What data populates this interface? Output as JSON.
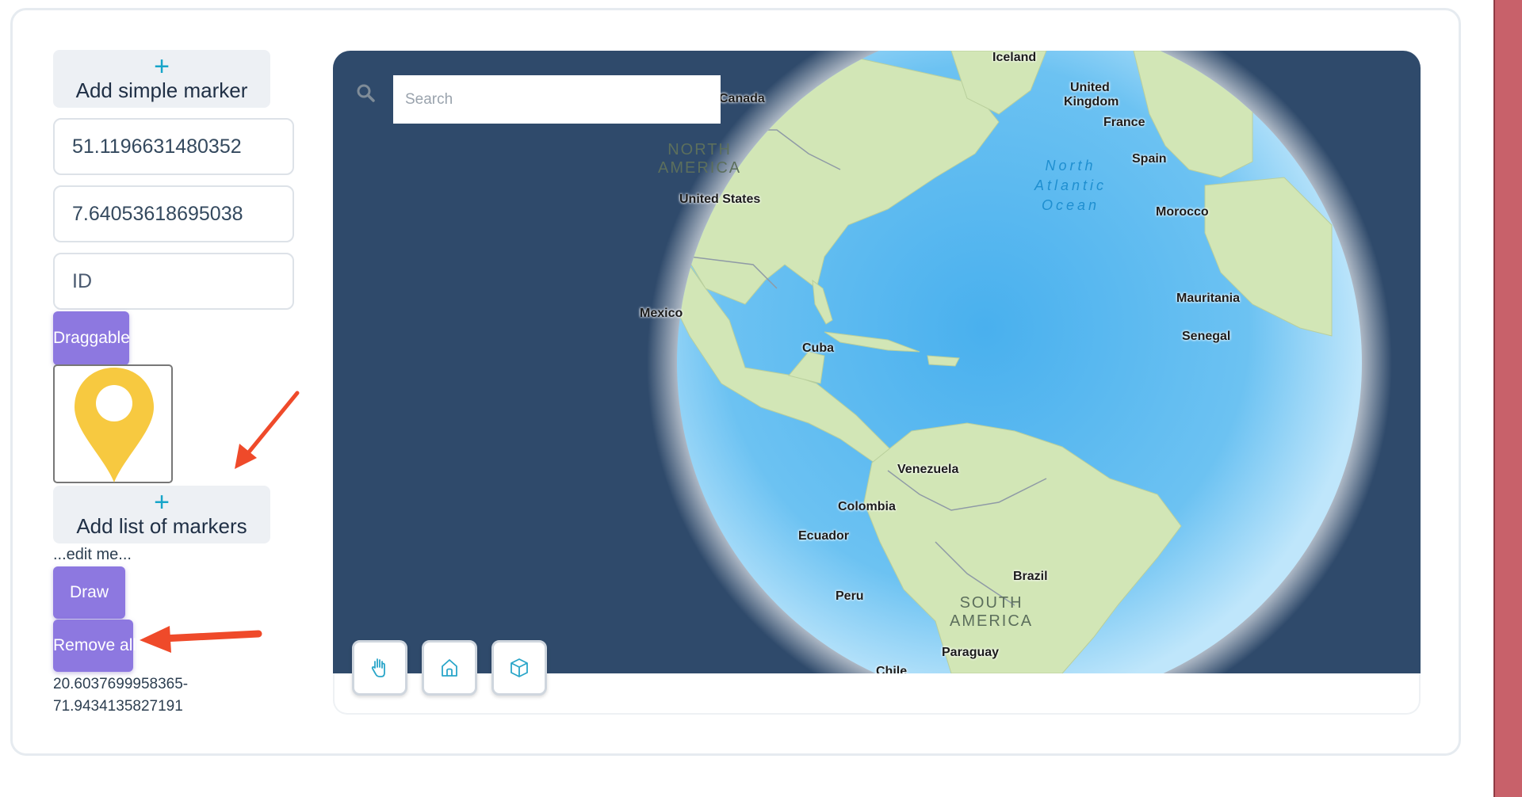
{
  "left_panel": {
    "add_simple_marker": {
      "icon": "plus",
      "label": "Add simple marker"
    },
    "latitude_value": "51.1196631480352",
    "longitude_value": "7.64053618695038",
    "id_placeholder": "ID",
    "draggable_label": "Draggable",
    "marker_preview": {
      "icon": "map-pin-icon",
      "color": "#f7c940"
    },
    "add_list_of_markers": {
      "icon": "plus",
      "label": "Add list of markers"
    },
    "edit_text": "...edit me...",
    "draw_label": "Draw",
    "remove_all_label": "Remove all",
    "coordinates_line1": "20.6037699958365-",
    "coordinates_line2": "71.9434135827191"
  },
  "map": {
    "search_placeholder": "Search",
    "labels": {
      "iceland": "Iceland",
      "united_kingdom_1": "United",
      "united_kingdom_2": "Kingdom",
      "france": "France",
      "spain": "Spain",
      "morocco": "Morocco",
      "mauritania": "Mauritania",
      "senegal": "Senegal",
      "canada": "Canada",
      "united_states": "United States",
      "mexico": "Mexico",
      "cuba": "Cuba",
      "venezuela": "Venezuela",
      "colombia": "Colombia",
      "ecuador": "Ecuador",
      "peru": "Peru",
      "brazil": "Brazil",
      "paraguay": "Paraguay",
      "chile": "Chile"
    },
    "regions": {
      "north_america_1": "NORTH",
      "north_america_2": "AMERICA",
      "south_america_1": "SOUTH",
      "south_america_2": "AMERICA"
    },
    "ocean": {
      "line1": "North",
      "line2": "Atlantic",
      "line3": "Ocean"
    },
    "controls": [
      "hand-pan-icon",
      "home-icon",
      "cube-3d-icon"
    ],
    "colors": {
      "space": "#2f4a6b",
      "ocean": "#5cbcf0",
      "land": "#cfe4b4"
    }
  },
  "annotations": {
    "arrow_color": "#ef4a2a"
  }
}
